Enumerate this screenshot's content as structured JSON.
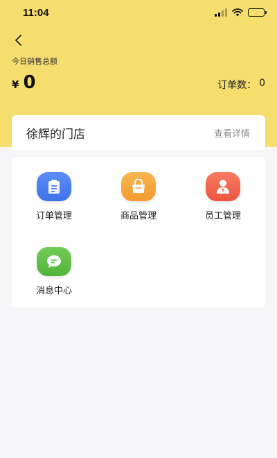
{
  "status_bar": {
    "time": "11:04",
    "icons": [
      "signal-icon",
      "wifi-icon",
      "battery-charging-icon"
    ],
    "battery_color": "#3cc85a"
  },
  "header": {
    "back_icon": "chevron-left-icon",
    "bg_color": "#f5dd6e",
    "sales_label": "今日销售总额",
    "currency_symbol": "¥",
    "sales_amount": "0",
    "order_count_label": "订单数：",
    "order_count_value": "0"
  },
  "store": {
    "name": "徐辉的门店",
    "detail_link": "查看详情"
  },
  "menu": {
    "items": [
      {
        "label": "订单管理",
        "icon": "clipboard-icon",
        "color": "#4a7ef0"
      },
      {
        "label": "商品管理",
        "icon": "shopping-bag-icon",
        "color": "#f5a83c"
      },
      {
        "label": "员工管理",
        "icon": "staff-icon",
        "color": "#f2674f"
      },
      {
        "label": "消息中心",
        "icon": "message-icon",
        "color": "#5fbf45"
      }
    ]
  }
}
